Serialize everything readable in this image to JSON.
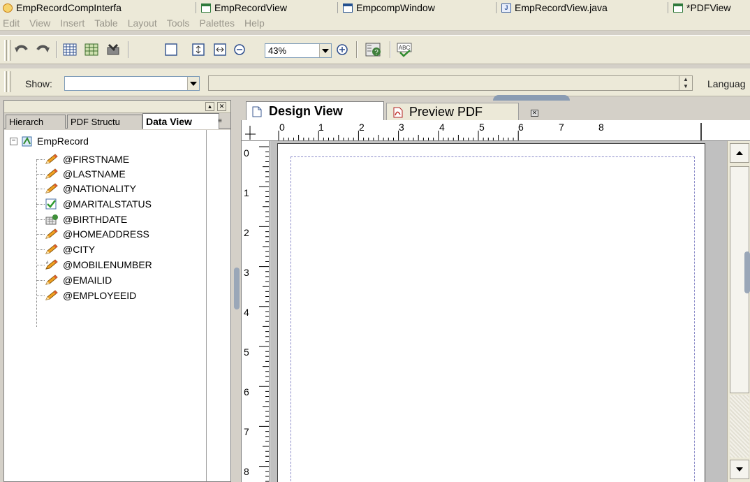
{
  "editor_tabs": [
    {
      "label": "EmpRecordCompInterfa",
      "icon": "component-icon"
    },
    {
      "label": "EmpRecordView",
      "icon": "form-icon"
    },
    {
      "label": "EmpcompWindow",
      "icon": "window-icon"
    },
    {
      "label": "EmpRecordView.java",
      "icon": "java-file-icon"
    },
    {
      "label": "*PDFView",
      "icon": "form-icon"
    }
  ],
  "menu": [
    "Edit",
    "View",
    "Insert",
    "Table",
    "Layout",
    "Tools",
    "Palettes",
    "Help"
  ],
  "toolbar": {
    "zoom_value": "43%",
    "icons": [
      "undo-icon",
      "redo-icon",
      "table-grid-icon",
      "table-edit-icon",
      "tools-icon",
      "page-icon",
      "fit-height-icon",
      "fit-width-icon",
      "zoom-out-icon",
      "zoom-in-icon",
      "help-icon",
      "spell-check-icon"
    ]
  },
  "show_bar": {
    "label": "Show:",
    "show_value": "",
    "language_label": "Languag"
  },
  "left_panel": {
    "tabs": [
      "Hierarch",
      "PDF Structu",
      "Data View"
    ],
    "active_tab": "Data View",
    "tree": {
      "root": "EmpRecord",
      "items": [
        {
          "label": "@FIRSTNAME",
          "type": "text-field"
        },
        {
          "label": "@LASTNAME",
          "type": "text-field"
        },
        {
          "label": "@NATIONALITY",
          "type": "text-field"
        },
        {
          "label": "@MARITALSTATUS",
          "type": "checkbox-field"
        },
        {
          "label": "@BIRTHDATE",
          "type": "date-field"
        },
        {
          "label": "@HOMEADDRESS",
          "type": "text-field"
        },
        {
          "label": "@CITY",
          "type": "text-field"
        },
        {
          "label": "@MOBILENUMBER",
          "type": "numeric-field"
        },
        {
          "label": "@EMAILID",
          "type": "text-field"
        },
        {
          "label": "@EMPLOYEEID",
          "type": "text-field"
        }
      ]
    }
  },
  "design": {
    "tabs": [
      {
        "label": "Design View",
        "active": true
      },
      {
        "label": "Preview PDF",
        "active": false
      }
    ],
    "hruler_numbers": [
      "0",
      "1",
      "2",
      "3",
      "4",
      "5",
      "6",
      "7",
      "8"
    ],
    "vruler_numbers": [
      "0",
      "1",
      "2",
      "3",
      "4",
      "5",
      "6",
      "7",
      "8"
    ]
  }
}
